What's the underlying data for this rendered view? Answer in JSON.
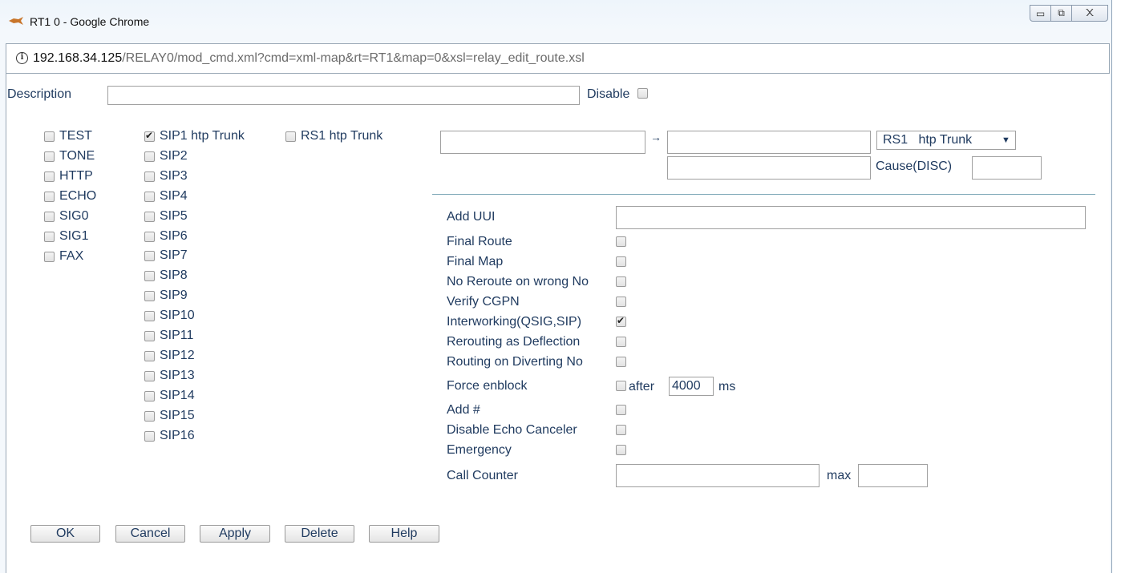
{
  "window": {
    "title": "RT1 0 - Google Chrome",
    "url_host": "192.168.34.125",
    "url_path": "/RELAY0/mod_cmd.xml?cmd=xml-map&rt=RT1&map=0&xsl=relay_edit_route.xsl",
    "minimize_glyph": "▭",
    "maximize_glyph": "⧉",
    "close_glyph": "᙭"
  },
  "form": {
    "description_label": "Description",
    "description_value": "",
    "disable_label": "Disable",
    "disable_checked": false
  },
  "interfaces_col1": [
    {
      "label": "TEST",
      "checked": false
    },
    {
      "label": "TONE",
      "checked": false
    },
    {
      "label": "HTTP",
      "checked": false
    },
    {
      "label": "ECHO",
      "checked": false
    },
    {
      "label": "SIG0",
      "checked": false
    },
    {
      "label": "SIG1",
      "checked": false
    },
    {
      "label": "FAX",
      "checked": false
    }
  ],
  "interfaces_col2": [
    {
      "label": "SIP1 htp Trunk",
      "checked": true
    },
    {
      "label": "SIP2",
      "checked": false
    },
    {
      "label": "SIP3",
      "checked": false
    },
    {
      "label": "SIP4",
      "checked": false
    },
    {
      "label": "SIP5",
      "checked": false
    },
    {
      "label": "SIP6",
      "checked": false
    },
    {
      "label": "SIP7",
      "checked": false
    },
    {
      "label": "SIP8",
      "checked": false
    },
    {
      "label": "SIP9",
      "checked": false
    },
    {
      "label": "SIP10",
      "checked": false
    },
    {
      "label": "SIP11",
      "checked": false
    },
    {
      "label": "SIP12",
      "checked": false
    },
    {
      "label": "SIP13",
      "checked": false
    },
    {
      "label": "SIP14",
      "checked": false
    },
    {
      "label": "SIP15",
      "checked": false
    },
    {
      "label": "SIP16",
      "checked": false
    }
  ],
  "interfaces_col3": [
    {
      "label": "RS1 htp Trunk",
      "checked": false
    }
  ],
  "mapping": {
    "arrow": "→",
    "source_value": "",
    "dest_value": "",
    "dest_interface_selected": "RS1   htp Trunk",
    "dest_interface_arrow": "▼",
    "second_value": "",
    "cause_label": "Cause(DISC)",
    "cause_value": ""
  },
  "options": {
    "add_uui_label": "Add UUI",
    "add_uui_value": "",
    "checkboxes": [
      {
        "label": "Final Route",
        "checked": false
      },
      {
        "label": "Final Map",
        "checked": false
      },
      {
        "label": "No Reroute on wrong No",
        "checked": false
      },
      {
        "label": "Verify CGPN",
        "checked": false
      },
      {
        "label": "Interworking(QSIG,SIP)",
        "checked": true
      },
      {
        "label": "Rerouting as Deflection",
        "checked": false
      },
      {
        "label": "Routing on Diverting No",
        "checked": false
      },
      {
        "label": "Force enblock",
        "checked": false
      },
      {
        "label": "Add #",
        "checked": false
      },
      {
        "label": "Disable Echo Canceler",
        "checked": false
      },
      {
        "label": "Emergency",
        "checked": false
      }
    ],
    "force_enblock_after_label": "after",
    "force_enblock_value": "4000",
    "force_enblock_unit": "ms",
    "call_counter_label": "Call Counter",
    "call_counter_value": "",
    "max_label": "max",
    "max_value": ""
  },
  "buttons": {
    "ok": "OK",
    "cancel": "Cancel",
    "apply": "Apply",
    "delete": "Delete",
    "help": "Help"
  }
}
